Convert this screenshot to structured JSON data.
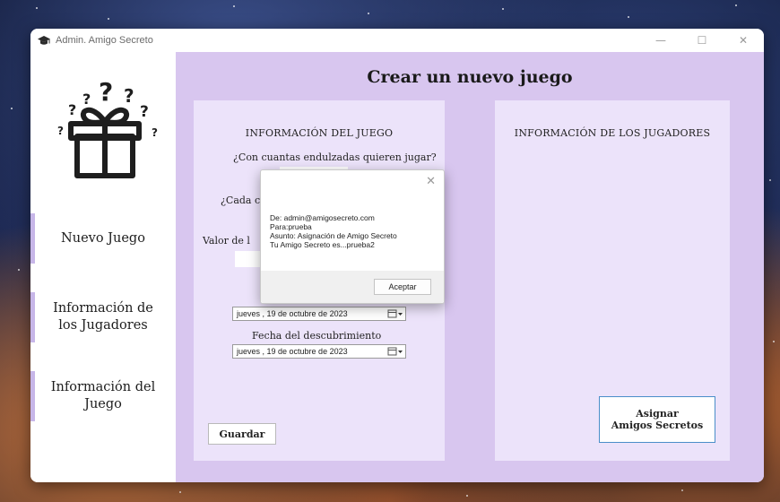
{
  "window": {
    "title": "Admin. Amigo Secreto",
    "minimize": "—",
    "maximize": "☐",
    "close": "✕"
  },
  "sidebar": {
    "items": [
      {
        "label": "Nuevo Juego"
      },
      {
        "label": "Información de\nlos Jugadores"
      },
      {
        "label": "Información del\nJuego"
      }
    ]
  },
  "main": {
    "title": "Crear un nuevo juego",
    "game_info": {
      "heading": "INFORMACIÓN DEL JUEGO",
      "question_sweets": "¿Con cuantas endulzadas quieren jugar?",
      "question_each": "¿Cada c",
      "value_label": "Valor de l",
      "date_start": "jueves  , 19 de  octubre  de 2023",
      "reveal_label": "Fecha del descubrimiento",
      "date_reveal": "jueves  , 19 de  octubre  de 2023",
      "save_button": "Guardar"
    },
    "players_info": {
      "heading": "INFORMACIÓN DE LOS JUGADORES",
      "assign_button": "Asignar\nAmigos Secretos"
    }
  },
  "dialog": {
    "line1": "De: admin@amigosecreto.com",
    "line2": "Para:prueba",
    "line3": "Asunto: Asignación de Amigo Secreto",
    "line4": "Tu Amigo Secreto es...prueba2",
    "accept_button": "Aceptar",
    "close": "✕"
  }
}
